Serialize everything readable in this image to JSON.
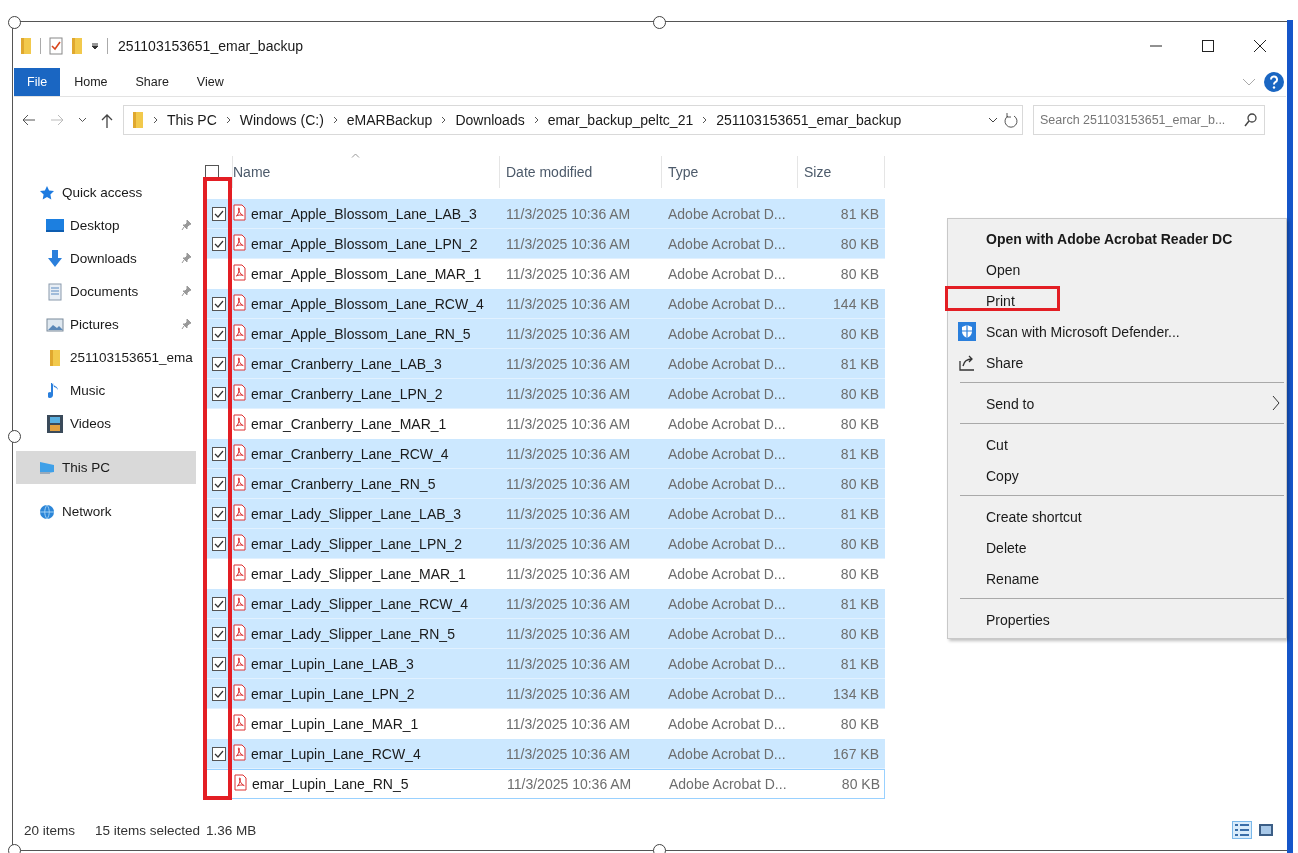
{
  "window": {
    "title": "251103153651_emar_backup"
  },
  "ribbon_tabs": [
    {
      "label": "File",
      "selected": true
    },
    {
      "label": "Home",
      "selected": false
    },
    {
      "label": "Share",
      "selected": false
    },
    {
      "label": "View",
      "selected": false
    }
  ],
  "address": {
    "path": [
      "This PC",
      "Windows (C:)",
      "eMARBackup",
      "Downloads",
      "emar_backup_peltc_21",
      "251103153651_emar_backup"
    ]
  },
  "search": {
    "placeholder": "Search 251103153651_emar_b..."
  },
  "sidebar": {
    "items": [
      {
        "kind": "quick-access",
        "label": "Quick access",
        "selected": false,
        "children": [
          {
            "kind": "desktop",
            "label": "Desktop",
            "pinned": true,
            "selected": false
          },
          {
            "kind": "downloads",
            "label": "Downloads",
            "pinned": true,
            "selected": false
          },
          {
            "kind": "documents",
            "label": "Documents",
            "pinned": true,
            "selected": false
          },
          {
            "kind": "pictures",
            "label": "Pictures",
            "pinned": true,
            "selected": false
          },
          {
            "kind": "folder",
            "label": "251103153651_ema",
            "pinned": false,
            "selected": false
          },
          {
            "kind": "music",
            "label": "Music",
            "pinned": false,
            "selected": false
          },
          {
            "kind": "videos",
            "label": "Videos",
            "pinned": false,
            "selected": false
          }
        ]
      },
      {
        "kind": "pc",
        "label": "This PC",
        "selected": true
      },
      {
        "kind": "network",
        "label": "Network",
        "selected": false
      }
    ]
  },
  "table": {
    "columns": [
      "Name",
      "Date modified",
      "Type",
      "Size"
    ],
    "header_checked": false,
    "checkbox_column_outlined": true,
    "rows": [
      {
        "name": "emar_Apple_Blossom_Lane_LAB_3",
        "date": "11/3/2025 10:36 AM",
        "type": "Adobe Acrobat D...",
        "size": "81 KB",
        "selected": true,
        "focused": false
      },
      {
        "name": "emar_Apple_Blossom_Lane_LPN_2",
        "date": "11/3/2025 10:36 AM",
        "type": "Adobe Acrobat D...",
        "size": "80 KB",
        "selected": true,
        "focused": false
      },
      {
        "name": "emar_Apple_Blossom_Lane_MAR_1",
        "date": "11/3/2025 10:36 AM",
        "type": "Adobe Acrobat D...",
        "size": "80 KB",
        "selected": false,
        "focused": false
      },
      {
        "name": "emar_Apple_Blossom_Lane_RCW_4",
        "date": "11/3/2025 10:36 AM",
        "type": "Adobe Acrobat D...",
        "size": "144 KB",
        "selected": true,
        "focused": false
      },
      {
        "name": "emar_Apple_Blossom_Lane_RN_5",
        "date": "11/3/2025 10:36 AM",
        "type": "Adobe Acrobat D...",
        "size": "80 KB",
        "selected": true,
        "focused": false
      },
      {
        "name": "emar_Cranberry_Lane_LAB_3",
        "date": "11/3/2025 10:36 AM",
        "type": "Adobe Acrobat D...",
        "size": "81 KB",
        "selected": true,
        "focused": false
      },
      {
        "name": "emar_Cranberry_Lane_LPN_2",
        "date": "11/3/2025 10:36 AM",
        "type": "Adobe Acrobat D...",
        "size": "80 KB",
        "selected": true,
        "focused": false
      },
      {
        "name": "emar_Cranberry_Lane_MAR_1",
        "date": "11/3/2025 10:36 AM",
        "type": "Adobe Acrobat D...",
        "size": "80 KB",
        "selected": false,
        "focused": false
      },
      {
        "name": "emar_Cranberry_Lane_RCW_4",
        "date": "11/3/2025 10:36 AM",
        "type": "Adobe Acrobat D...",
        "size": "81 KB",
        "selected": true,
        "focused": false
      },
      {
        "name": "emar_Cranberry_Lane_RN_5",
        "date": "11/3/2025 10:36 AM",
        "type": "Adobe Acrobat D...",
        "size": "80 KB",
        "selected": true,
        "focused": false
      },
      {
        "name": "emar_Lady_Slipper_Lane_LAB_3",
        "date": "11/3/2025 10:36 AM",
        "type": "Adobe Acrobat D...",
        "size": "81 KB",
        "selected": true,
        "focused": false
      },
      {
        "name": "emar_Lady_Slipper_Lane_LPN_2",
        "date": "11/3/2025 10:36 AM",
        "type": "Adobe Acrobat D...",
        "size": "80 KB",
        "selected": true,
        "focused": false
      },
      {
        "name": "emar_Lady_Slipper_Lane_MAR_1",
        "date": "11/3/2025 10:36 AM",
        "type": "Adobe Acrobat D...",
        "size": "80 KB",
        "selected": false,
        "focused": false
      },
      {
        "name": "emar_Lady_Slipper_Lane_RCW_4",
        "date": "11/3/2025 10:36 AM",
        "type": "Adobe Acrobat D...",
        "size": "81 KB",
        "selected": true,
        "focused": false
      },
      {
        "name": "emar_Lady_Slipper_Lane_RN_5",
        "date": "11/3/2025 10:36 AM",
        "type": "Adobe Acrobat D...",
        "size": "80 KB",
        "selected": true,
        "focused": false
      },
      {
        "name": "emar_Lupin_Lane_LAB_3",
        "date": "11/3/2025 10:36 AM",
        "type": "Adobe Acrobat D...",
        "size": "81 KB",
        "selected": true,
        "focused": false
      },
      {
        "name": "emar_Lupin_Lane_LPN_2",
        "date": "11/3/2025 10:36 AM",
        "type": "Adobe Acrobat D...",
        "size": "134 KB",
        "selected": true,
        "focused": false
      },
      {
        "name": "emar_Lupin_Lane_MAR_1",
        "date": "11/3/2025 10:36 AM",
        "type": "Adobe Acrobat D...",
        "size": "80 KB",
        "selected": false,
        "focused": false
      },
      {
        "name": "emar_Lupin_Lane_RCW_4",
        "date": "11/3/2025 10:36 AM",
        "type": "Adobe Acrobat D...",
        "size": "167 KB",
        "selected": true,
        "focused": false
      },
      {
        "name": "emar_Lupin_Lane_RN_5",
        "date": "11/3/2025 10:36 AM",
        "type": "Adobe Acrobat D...",
        "size": "80 KB",
        "selected": false,
        "focused": true
      }
    ]
  },
  "context_menu": {
    "items": [
      {
        "kind": "default",
        "label": "Open with Adobe Acrobat Reader DC",
        "outlined": false
      },
      {
        "kind": "item",
        "label": "Open",
        "outlined": false
      },
      {
        "kind": "item",
        "label": "Print",
        "outlined": true
      },
      {
        "kind": "scan",
        "label": "Scan with Microsoft Defender...",
        "outlined": false
      },
      {
        "kind": "share",
        "label": "Share",
        "outlined": false
      },
      {
        "kind": "separator"
      },
      {
        "kind": "submenu",
        "label": "Send to",
        "outlined": false
      },
      {
        "kind": "separator"
      },
      {
        "kind": "item",
        "label": "Cut",
        "outlined": false
      },
      {
        "kind": "item",
        "label": "Copy",
        "outlined": false
      },
      {
        "kind": "separator"
      },
      {
        "kind": "item",
        "label": "Create shortcut",
        "outlined": false
      },
      {
        "kind": "item",
        "label": "Delete",
        "outlined": false
      },
      {
        "kind": "item",
        "label": "Rename",
        "outlined": false
      },
      {
        "kind": "separator"
      },
      {
        "kind": "item",
        "label": "Properties",
        "outlined": false
      }
    ]
  },
  "status_bar": {
    "item_count": "20 items",
    "selection": "15 items selected",
    "size": "1.36 MB"
  },
  "view_buttons": [
    {
      "kind": "details",
      "selected": true
    },
    {
      "kind": "large-icons",
      "selected": false
    }
  ]
}
